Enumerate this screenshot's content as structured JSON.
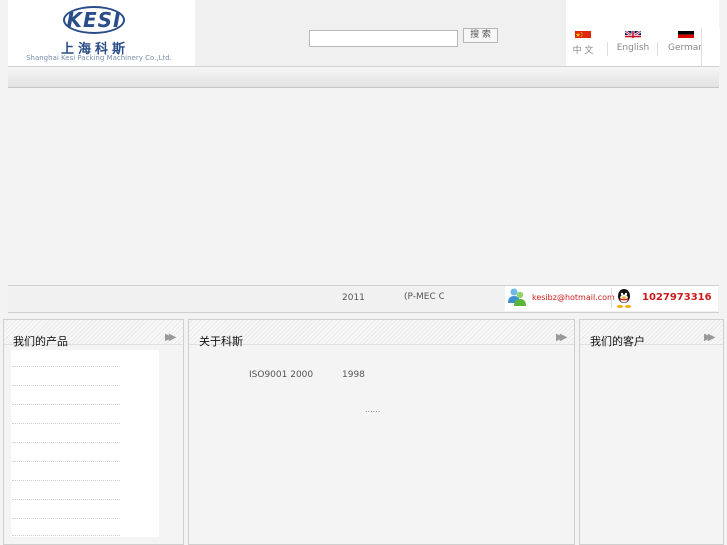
{
  "header": {
    "logo": {
      "mark": "KESI",
      "name_cn": "上海科斯",
      "name_en": "Shanghai Kesi Packing Machinery Co.,Ltd."
    },
    "search": {
      "placeholder": "",
      "button_label": "搜 索"
    },
    "languages": [
      {
        "label": "中 文",
        "flag": "china-flag"
      },
      {
        "label": "English",
        "flag": "uk-flag"
      },
      {
        "label": "German",
        "flag": "germany-flag"
      }
    ]
  },
  "info_bar": {
    "year": "2011",
    "company": "(P-MEC C",
    "email": "kesibz@hotmail.com",
    "qq": "1027973316"
  },
  "panels": {
    "products": {
      "title": "我们的产品"
    },
    "about": {
      "title": "关于科斯",
      "iso_text": "ISO9001 2000",
      "year": "1998",
      "more": "......"
    },
    "clients": {
      "title": "我们的客户"
    }
  },
  "colors": {
    "brand": "#2a4d8a",
    "contact_red": "#cc1a1a"
  },
  "icons": [
    "msn-icon",
    "qq-icon",
    "double-arrow-icon"
  ]
}
